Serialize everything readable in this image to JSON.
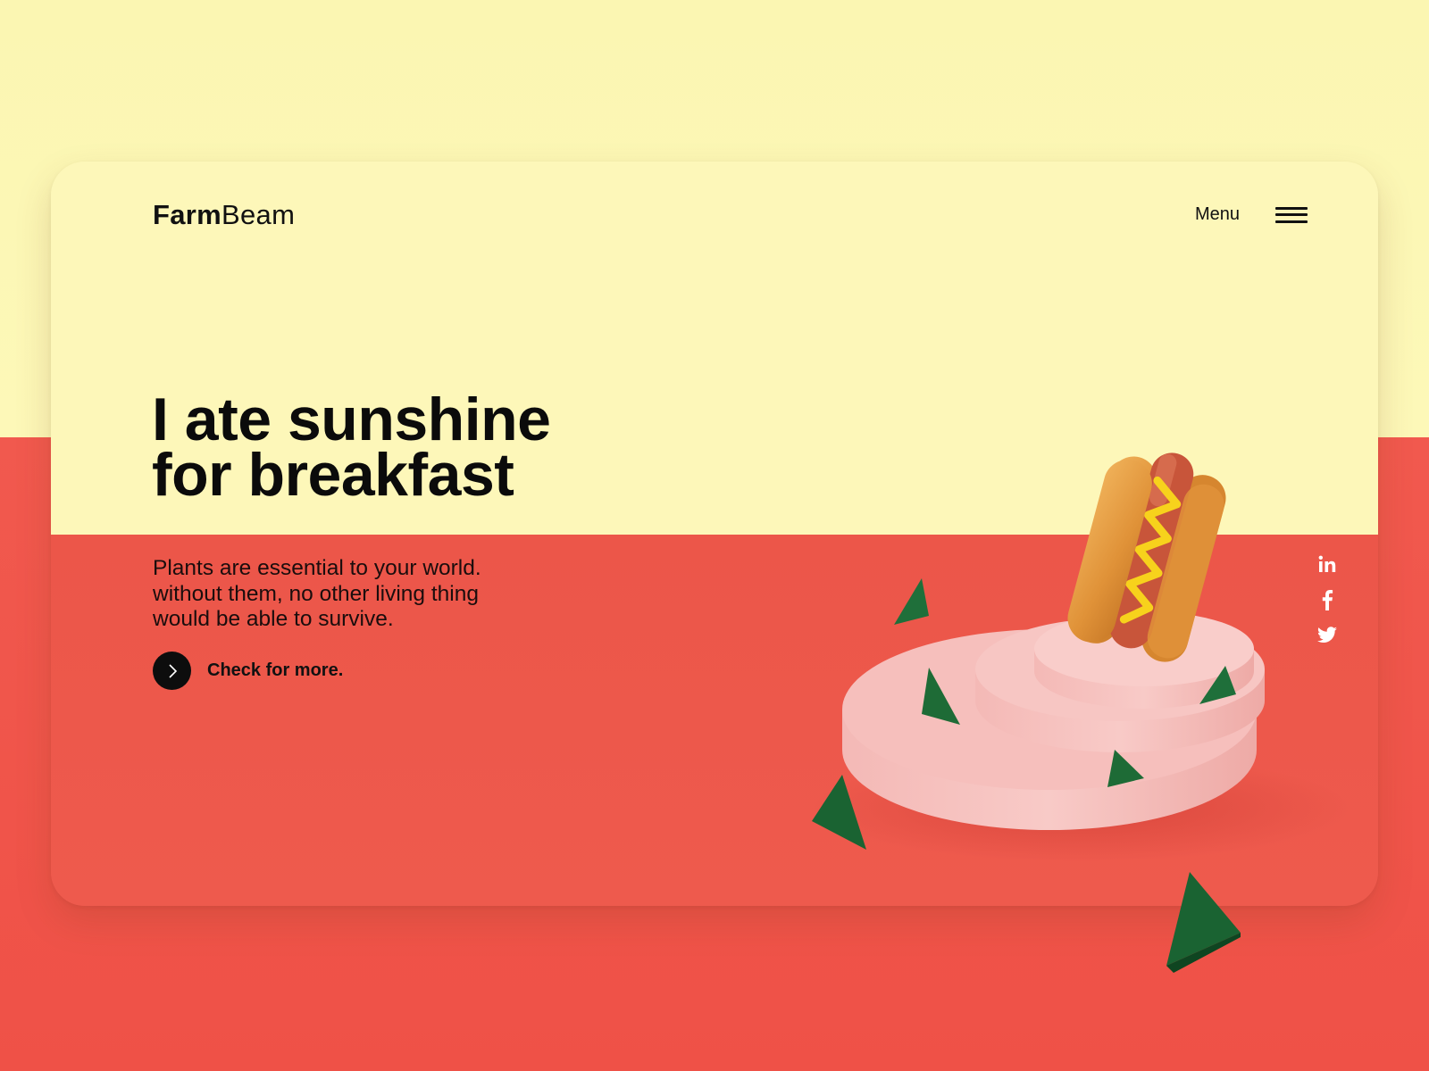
{
  "brand": {
    "bold": "Farm",
    "light": "Beam"
  },
  "nav": {
    "menu_label": "Menu"
  },
  "hero": {
    "headline_line1": "I ate sunshine",
    "headline_line2": "for breakfast",
    "body_line1": "Plants are essential to your world.",
    "body_line2": "without them, no other living thing",
    "body_line3": "would be able to survive.",
    "cta_label": "Check for more."
  },
  "social": [
    {
      "name": "LinkedIn",
      "icon": "linkedin-icon"
    },
    {
      "name": "Facebook",
      "icon": "facebook-icon"
    },
    {
      "name": "Twitter",
      "icon": "twitter-icon"
    }
  ],
  "colors": {
    "yellow": "#fdf7b9",
    "red": "#ee5a4d",
    "ink": "#0b0b0b",
    "pedestal": "#f7c3c0",
    "triangle": "#1e6b36"
  }
}
